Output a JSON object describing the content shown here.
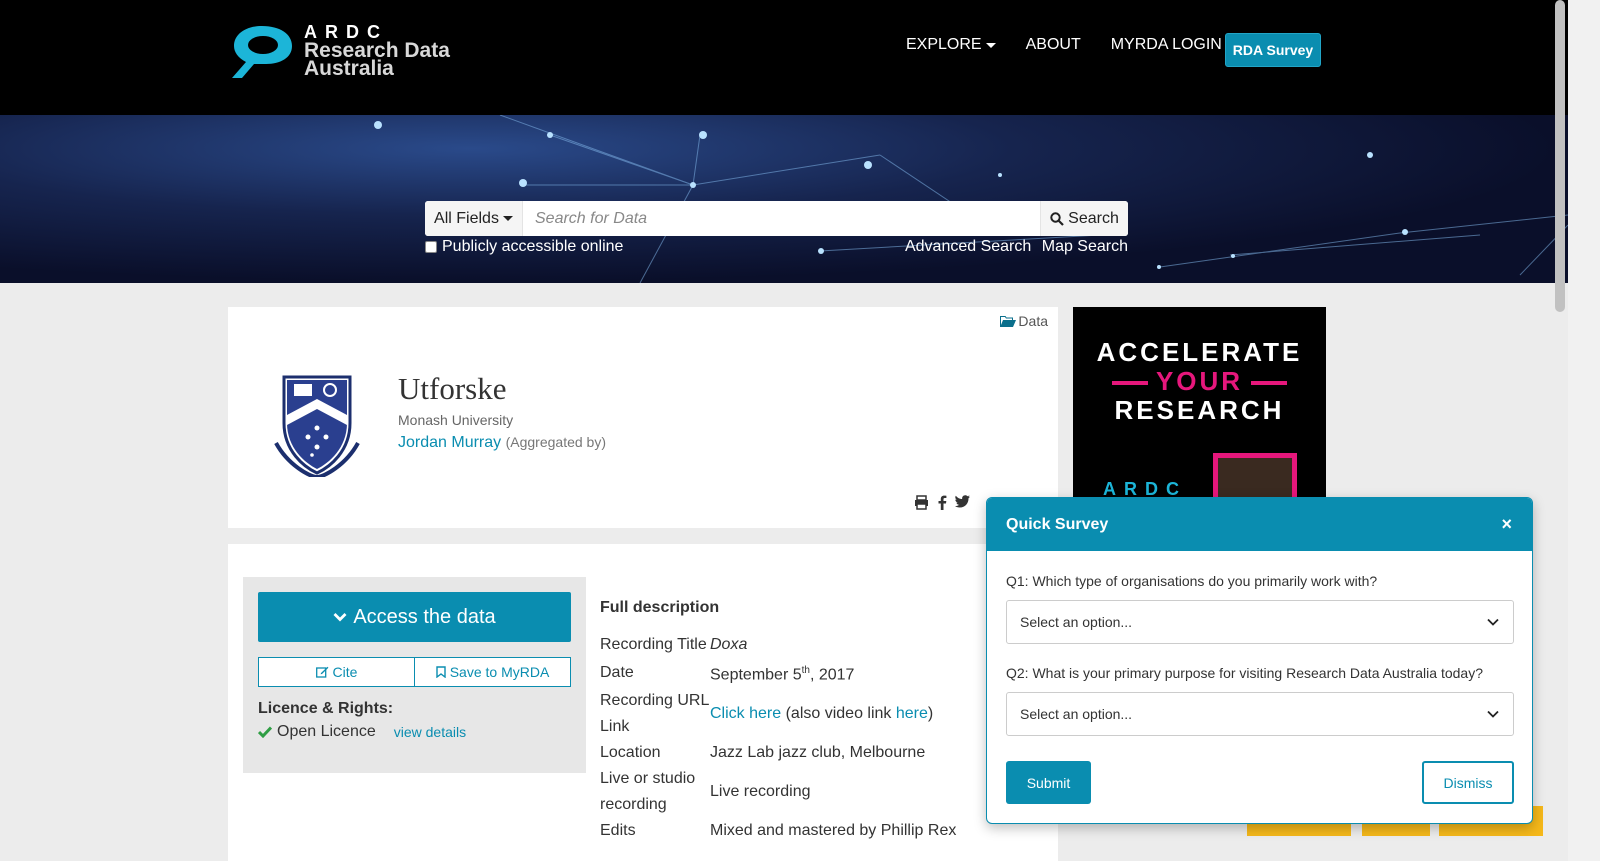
{
  "header": {
    "logo_ardc": "ARDC",
    "logo_line1": "Research Data",
    "logo_line2": "Australia",
    "nav": [
      {
        "label": "EXPLORE",
        "has_dropdown": true
      },
      {
        "label": "ABOUT",
        "has_dropdown": false
      },
      {
        "label": "MYRDA LOGIN",
        "has_dropdown": false
      }
    ],
    "survey_button": "RDA Survey"
  },
  "search": {
    "field_select": "All Fields",
    "placeholder": "Search for Data",
    "button": "Search",
    "public_checkbox_label": "Publicly accessible online",
    "public_checked": false,
    "advanced_link": "Advanced Search",
    "map_link": "Map Search"
  },
  "record": {
    "type_tag": "Data",
    "title": "Utforske",
    "organisation": "Monash University",
    "person": "Jordan Murray",
    "person_role": "(Aggregated by)"
  },
  "access": {
    "access_button": "Access the data",
    "cite_button": "Cite",
    "save_button": "Save to MyRDA",
    "licence_heading": "Licence & Rights:",
    "licence_value": "Open Licence",
    "view_details": "view details"
  },
  "description": {
    "heading": "Full description",
    "rows": [
      {
        "label": "Recording Title",
        "value": "Doxa"
      },
      {
        "label": "Date",
        "value_prefix": "September 5",
        "value_sup": "th",
        "value_suffix": ", 2017"
      },
      {
        "label_line1": "Recording URL",
        "label_line2": "Link",
        "link1": "Click here",
        "mid": " (also video link ",
        "link2": "here",
        "end": ")"
      },
      {
        "label": "Location",
        "value": "Jazz Lab jazz club, Melbourne"
      },
      {
        "label_line1": "Live or studio",
        "label_line2": "recording",
        "value": "Live recording"
      },
      {
        "label": "Edits",
        "value": "Mixed and mastered by Phillip Rex"
      }
    ]
  },
  "ad": {
    "line1": "ACCELERATE",
    "line2": "YOUR",
    "line3": "RESEARCH",
    "brand": "ARDC"
  },
  "survey": {
    "title": "Quick Survey",
    "close": "×",
    "q1": "Q1: Which type of organisations do you primarily work with?",
    "q1_value": "Select an option...",
    "q2": "Q2: What is your primary purpose for visiting Research Data Australia today?",
    "q2_value": "Select an option...",
    "submit": "Submit",
    "dismiss": "Dismiss"
  },
  "colors": {
    "accent": "#0a8db0",
    "header_bg": "#000000",
    "page_bg": "#ececec",
    "ad_pink": "#e6177c",
    "yellow_tab": "#f5b81a"
  }
}
